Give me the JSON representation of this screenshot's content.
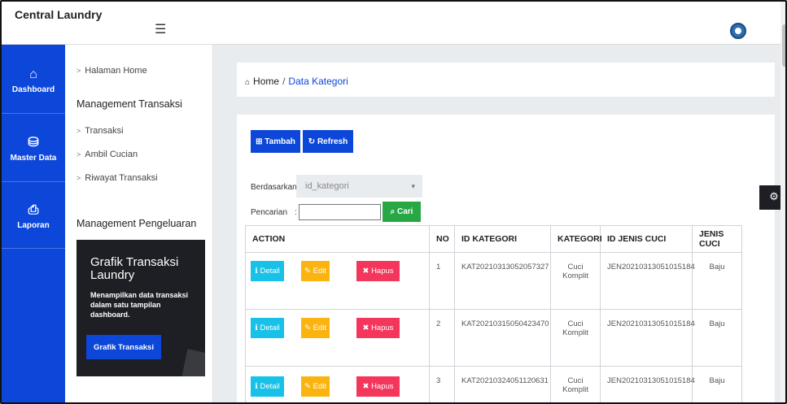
{
  "app": {
    "brand": "Central Laundry"
  },
  "rail": [
    {
      "icon": "home-icon",
      "glyph": "⌂",
      "label": "Dashboard"
    },
    {
      "icon": "database-icon",
      "glyph": "⛁",
      "label": "Master Data"
    },
    {
      "icon": "printer-icon",
      "glyph": "⎙",
      "label": "Laporan"
    }
  ],
  "sidebar": {
    "home": "Halaman Home",
    "section1": "Management Transaksi",
    "items": [
      "Transaksi",
      "Ambil Cucian",
      "Riwayat Transaksi"
    ],
    "section2": "Management Pengeluaran",
    "promo": {
      "title": "Grafik Transaksi Laundry",
      "desc": "Menampilkan data transaksi dalam satu tampilan dashboard.",
      "button": "Grafik Transaksi"
    }
  },
  "breadcrumb": {
    "home": "Home",
    "separator": "/",
    "current": "Data Kategori"
  },
  "toolbar": {
    "tambah": "Tambah",
    "refresh": "Refresh"
  },
  "filter": {
    "by_label": "Berdasarkan :",
    "by_value": "id_kategori",
    "search_label": "Pencarian",
    "search_colon": ":",
    "search_value": "",
    "search_button": "Cari"
  },
  "table": {
    "headers": [
      "ACTION",
      "NO",
      "ID KATEGORI",
      "KATEGORI",
      "ID JENIS CUCI",
      "JENIS CUCI"
    ],
    "actions": {
      "detail": "Detail",
      "edit": "Edit",
      "hapus": "Hapus"
    },
    "rows": [
      {
        "no": "1",
        "id_kategori": "KAT20210313052057327",
        "kategori": "Cuci Komplit",
        "id_jenis_cuci": "JEN20210313051015184",
        "jenis_cuci": "Baju"
      },
      {
        "no": "2",
        "id_kategori": "KAT20210315050423470",
        "kategori": "Cuci Komplit",
        "id_jenis_cuci": "JEN20210313051015184",
        "jenis_cuci": "Baju"
      },
      {
        "no": "3",
        "id_kategori": "KAT20210324051120631",
        "kategori": "Cuci Komplit",
        "id_jenis_cuci": "JEN20210313051015184",
        "jenis_cuci": "Baju"
      }
    ]
  },
  "colors": {
    "primary": "#0d47d9",
    "success": "#28a745",
    "info": "#17c1e8",
    "warning": "#fbb40f",
    "danger": "#f5365c"
  }
}
